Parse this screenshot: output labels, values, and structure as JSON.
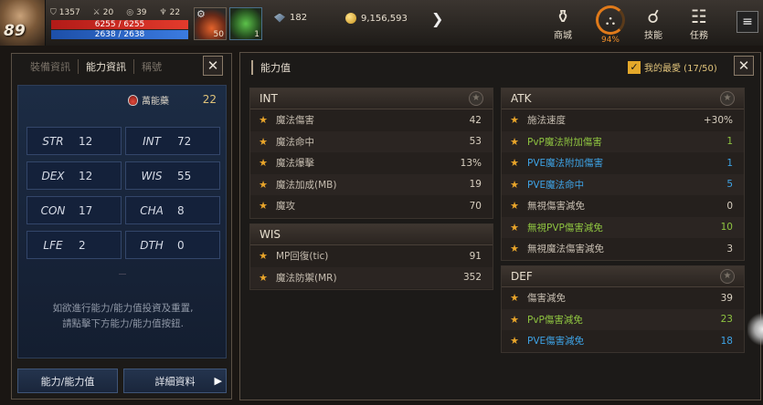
{
  "hud": {
    "level": "89",
    "stat1": "1357",
    "stat2": "20",
    "stat3": "39",
    "stat4": "22",
    "hp": "6255 / 6255",
    "mp": "2638 / 2638",
    "slot1_count": "50",
    "slot2_count": "1",
    "currency1": "182",
    "currency2": "9,156,593",
    "menu": {
      "shop": "商城",
      "bag_pct": "94%",
      "skill": "技能",
      "quest": "任務"
    }
  },
  "left_panel": {
    "tabs": [
      "裝備資訊",
      "能力資訊",
      "稱號"
    ],
    "potion_label": "萬能藥",
    "potion_count": "22",
    "stats": [
      {
        "key": "STR",
        "value": "12"
      },
      {
        "key": "INT",
        "value": "72"
      },
      {
        "key": "DEX",
        "value": "12"
      },
      {
        "key": "WIS",
        "value": "55"
      },
      {
        "key": "CON",
        "value": "17"
      },
      {
        "key": "CHA",
        "value": "8"
      },
      {
        "key": "LFE",
        "value": "2"
      },
      {
        "key": "DTH",
        "value": "0"
      }
    ],
    "hint_line1": "如欲進行能力/能力值投資及重置,",
    "hint_line2": "請點擊下方能力/能力值按鈕.",
    "btn_stats": "能力/能力值",
    "btn_detail": "詳細資料"
  },
  "right_panel": {
    "title": "能力值",
    "favorite": "我的最愛 (17/50)",
    "int": {
      "header": "INT",
      "rows": [
        {
          "name": "魔法傷害",
          "value": "42"
        },
        {
          "name": "魔法命中",
          "value": "53"
        },
        {
          "name": "魔法爆擊",
          "value": "13%"
        },
        {
          "name": "魔法加成(MB)",
          "value": "19"
        },
        {
          "name": "魔攻",
          "value": "70"
        }
      ]
    },
    "wis": {
      "header": "WIS",
      "rows": [
        {
          "name": "MP回復(tic)",
          "value": "91"
        },
        {
          "name": "魔法防禦(MR)",
          "value": "352"
        }
      ]
    },
    "atk": {
      "header": "ATK",
      "rows": [
        {
          "name": "施法速度",
          "value": "+30%",
          "color": "default"
        },
        {
          "name": "PvP魔法附加傷害",
          "value": "1",
          "color": "green"
        },
        {
          "name": "PVE魔法附加傷害",
          "value": "1",
          "color": "blue"
        },
        {
          "name": "PVE魔法命中",
          "value": "5",
          "color": "blue"
        },
        {
          "name": "無視傷害減免",
          "value": "0",
          "color": "default"
        },
        {
          "name": "無視PVP傷害減免",
          "value": "10",
          "color": "green"
        },
        {
          "name": "無視魔法傷害減免",
          "value": "3",
          "color": "default"
        }
      ]
    },
    "def": {
      "header": "DEF",
      "rows": [
        {
          "name": "傷害減免",
          "value": "39",
          "color": "default"
        },
        {
          "name": "PvP傷害減免",
          "value": "23",
          "color": "green"
        },
        {
          "name": "PVE傷害減免",
          "value": "18",
          "color": "blue"
        }
      ]
    }
  },
  "colors": {
    "accent_orange": "#e9a52a",
    "pvp_green": "#8ec340",
    "pve_blue": "#3ea3e6",
    "hp_red": "#e23b2c",
    "mp_blue": "#3b7be0"
  }
}
